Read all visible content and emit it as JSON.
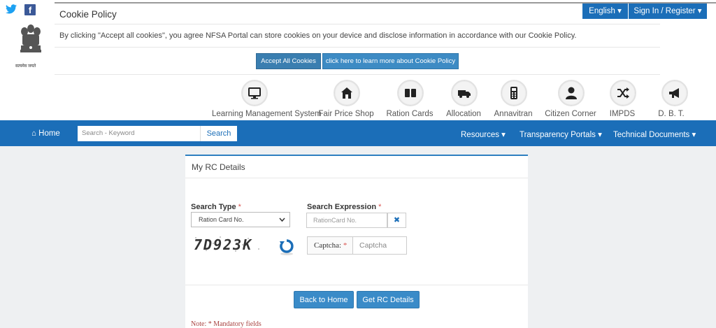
{
  "header": {
    "cookie_title": "Cookie Policy",
    "cookie_message": "By clicking \"Accept all cookies\", you agree NFSA Portal can store cookies on your device and disclose information in accordance with our Cookie Policy.",
    "accept_label": "Accept All Cookies",
    "learn_label": "click here to learn more about Cookie Policy",
    "language_label": "English ▾",
    "signin_label": "Sign In / Register ▾",
    "emblem_caption": "सत्यमेव जयते"
  },
  "services": [
    {
      "label": "Learning Management System",
      "icon": "monitor-icon"
    },
    {
      "label": "Fair Price Shop",
      "icon": "house-icon"
    },
    {
      "label": "Ration Cards",
      "icon": "book-icon"
    },
    {
      "label": "Allocation",
      "icon": "truck-icon"
    },
    {
      "label": "Annavitran",
      "icon": "pos-device-icon"
    },
    {
      "label": "Citizen Corner",
      "icon": "user-icon"
    },
    {
      "label": "IMPDS",
      "icon": "shuffle-icon"
    },
    {
      "label": "D. B. T.",
      "icon": "megaphone-icon"
    }
  ],
  "nav": {
    "home_label": "Home",
    "search_placeholder": "Search - Keyword",
    "search_button": "Search",
    "resources": "Resources ▾",
    "transparency": "Transparency Portals ▾",
    "technical": "Technical Documents ▾"
  },
  "form": {
    "title": "My RC Details",
    "search_type_label": "Search Type",
    "search_type_value": "Ration Card No.",
    "search_expr_label": "Search Expression",
    "search_expr_placeholder": "RationCard No.",
    "required_mark": "*",
    "captcha_text": "7D923K",
    "captcha_label": "Captcha:",
    "captcha_placeholder": "Captcha",
    "clear_symbol": "✖",
    "back_label": "Back to Home",
    "get_label": "Get RC Details",
    "note": "Note: * Mandatory fields"
  },
  "colors": {
    "primary": "#1b6eb8",
    "button": "#3a8bc8",
    "required": "#d9534f"
  }
}
